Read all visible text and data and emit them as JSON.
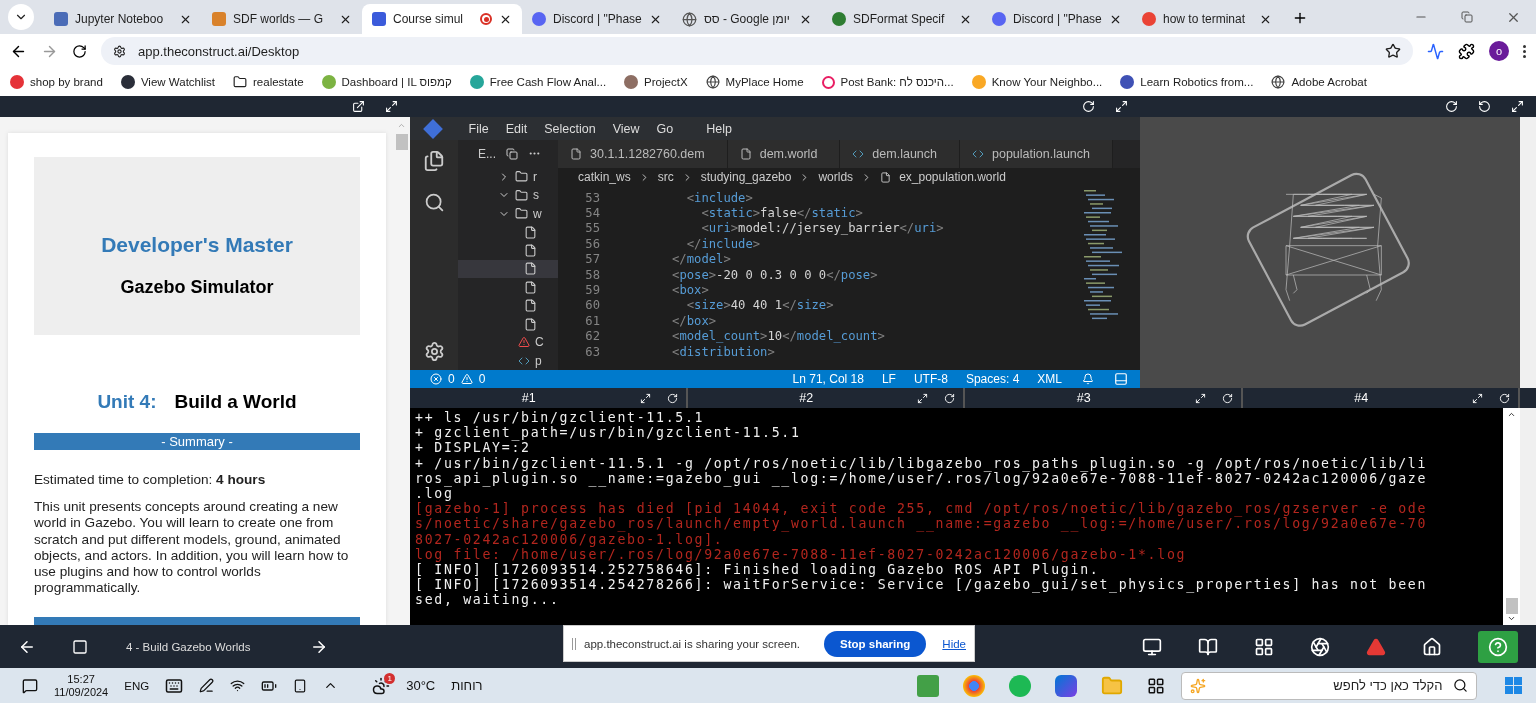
{
  "browser": {
    "tabs": [
      {
        "title": "Jupyter Noteboo",
        "kind": "jupyter",
        "selected": false,
        "recording": false
      },
      {
        "title": "SDF worlds — G",
        "kind": "sdf",
        "selected": false,
        "recording": false
      },
      {
        "title": "Course simul",
        "kind": "course",
        "selected": true,
        "recording": true
      },
      {
        "title": "Discord | \"Phase",
        "kind": "discord",
        "selected": false,
        "recording": false
      },
      {
        "title": "סס - Google יומן",
        "kind": "globe",
        "selected": false,
        "recording": false
      },
      {
        "title": "SDFormat Specif",
        "kind": "sdformat",
        "selected": false,
        "recording": false
      },
      {
        "title": "Discord | \"Phase",
        "kind": "discord",
        "selected": false,
        "recording": false
      },
      {
        "title": "how to terminat",
        "kind": "google",
        "selected": false,
        "recording": false
      }
    ],
    "address": "app.theconstruct.ai/Desktop",
    "profile_initial": "o",
    "bookmarks": [
      {
        "label": "shop by brand",
        "kind": "badge",
        "color": "#e53238"
      },
      {
        "label": "View Watchlist",
        "kind": "badge",
        "color": "#2a2e39"
      },
      {
        "label": "realestate",
        "kind": "folder"
      },
      {
        "label": "Dashboard | IL קמפוס",
        "kind": "badge",
        "color": "#7cb342"
      },
      {
        "label": "Free Cash Flow Anal...",
        "kind": "badge",
        "color": "#26a69a"
      },
      {
        "label": "ProjectX",
        "kind": "badge",
        "color": "#8d6e63"
      },
      {
        "label": "MyPlace Home",
        "kind": "globe"
      },
      {
        "label": "Post Bank: היכנס לח...",
        "kind": "ring"
      },
      {
        "label": "Know Your Neighbo...",
        "kind": "badge",
        "color": "#f9a825"
      },
      {
        "label": "Learn Robotics from...",
        "kind": "badge",
        "color": "#3f51b5"
      },
      {
        "label": "Adobe Acrobat",
        "kind": "globe"
      }
    ]
  },
  "course": {
    "title": "Developer's Master",
    "subtitle": "Gazebo Simulator",
    "unit_label": "Unit 4:",
    "unit_title": "Build a World",
    "summary_heading": "- Summary -",
    "estimate": "Estimated time to completion: **4 hours**",
    "description": "This unit presents concepts around creating a new world in Gazebo. You will learn to create one from scratch and put different models, ground, animated objects, and actors. In addition, you will learn how to use plugins and how to control worlds programmatically."
  },
  "editor": {
    "menu": [
      "File",
      "Edit",
      "Selection",
      "View",
      "Go",
      "Help"
    ],
    "explorer_label": "E...",
    "tree": [
      {
        "kind": "folder",
        "label": "r",
        "expanded": false
      },
      {
        "kind": "folder",
        "label": "s",
        "expanded": true
      },
      {
        "kind": "folder",
        "label": "w",
        "expanded": true,
        "children": [
          {
            "kind": "file",
            "selected": false
          },
          {
            "kind": "file",
            "selected": false
          },
          {
            "kind": "file",
            "selected": true
          },
          {
            "kind": "file",
            "selected": false
          },
          {
            "kind": "file",
            "selected": false
          },
          {
            "kind": "file",
            "selected": false
          }
        ]
      },
      {
        "kind": "warning",
        "label": "C"
      },
      {
        "kind": "code",
        "label": "p"
      }
    ],
    "tabs": [
      {
        "label": "30.1.1.1282760.dem",
        "kind": "file"
      },
      {
        "label": "dem.world",
        "kind": "file"
      },
      {
        "label": "dem.launch",
        "kind": "code"
      },
      {
        "label": "population.launch",
        "kind": "code"
      }
    ],
    "breadcrumb": [
      "catkin_ws",
      "src",
      "studying_gazebo",
      "worlds",
      "ex_population.world"
    ],
    "lines": [
      {
        "number": "53",
        "text": "        <include>"
      },
      {
        "number": "54",
        "text": "          <static>false</static>"
      },
      {
        "number": "55",
        "text": "          <uri>model://jersey_barrier</uri>"
      },
      {
        "number": "56",
        "text": "        </include>"
      },
      {
        "number": "57",
        "text": "      </model>"
      },
      {
        "number": "58",
        "text": "      <pose>-20 0 0.3 0 0 0</pose>"
      },
      {
        "number": "59",
        "text": "      <box>"
      },
      {
        "number": "60",
        "text": "        <size>40 40 1</size>"
      },
      {
        "number": "61",
        "text": "      </box>"
      },
      {
        "number": "62",
        "text": "      <model_count>10</model_count>"
      },
      {
        "number": "63",
        "text": "      <distribution>"
      }
    ],
    "status": {
      "errors": "0",
      "warnings": "0",
      "items": [
        "Ln 71, Col 18",
        "LF",
        "UTF-8",
        "Spaces: 4",
        "XML"
      ]
    }
  },
  "terminal": {
    "tabs": [
      "#1",
      "#2",
      "#3",
      "#4"
    ],
    "lines": [
      {
        "kind": "normal",
        "text": "++ ls /usr/bin/gzclient-11.5.1"
      },
      {
        "kind": "normal",
        "text": "+ gzclient_path=/usr/bin/gzclient-11.5.1"
      },
      {
        "kind": "normal",
        "text": "+ DISPLAY=:2"
      },
      {
        "kind": "normal",
        "text": "+ /usr/bin/gzclient-11.5.1 -g /opt/ros/noetic/lib/libgazebo_ros_paths_plugin.so -g /opt/ros/noetic/lib/li"
      },
      {
        "kind": "normal",
        "text": "ros_api_plugin.so __name:=gazebo_gui __log:=/home/user/.ros/log/92a0e67e-7088-11ef-8027-0242ac120006/gaze"
      },
      {
        "kind": "normal",
        "text": ".log"
      },
      {
        "kind": "error",
        "text": "[gazebo-1] process has died [pid 14044, exit code 255, cmd /opt/ros/noetic/lib/gazebo_ros/gzserver -e ode"
      },
      {
        "kind": "error",
        "text": "s/noetic/share/gazebo_ros/launch/empty_world.launch __name:=gazebo __log:=/home/user/.ros/log/92a0e67e-70"
      },
      {
        "kind": "error",
        "text": "8027-0242ac120006/gazebo-1.log]."
      },
      {
        "kind": "error",
        "text": "log file: /home/user/.ros/log/92a0e67e-7088-11ef-8027-0242ac120006/gazebo-1*.log"
      },
      {
        "kind": "normal",
        "text": "[ INFO] [1726093514.252758646]: Finished loading Gazebo ROS API Plugin."
      },
      {
        "kind": "normal",
        "text": "[ INFO] [1726093514.254278266]: waitForService: Service [/gazebo_gui/set_physics_properties] has not been"
      },
      {
        "kind": "normal",
        "text": "sed, waiting..."
      }
    ]
  },
  "app_bar": {
    "unit": "4 - Build Gazebo Worlds"
  },
  "share_notice": {
    "message": "app.theconstruct.ai is sharing your screen.",
    "stop": "Stop sharing",
    "hide": "Hide"
  },
  "taskbar": {
    "time": "15:27",
    "date": "11/09/2024",
    "language": "ENG",
    "weather_badge": "1",
    "temperature": "30°C",
    "weather": "רוחות",
    "search_placeholder": "הקלד כאן כדי לחפש"
  }
}
